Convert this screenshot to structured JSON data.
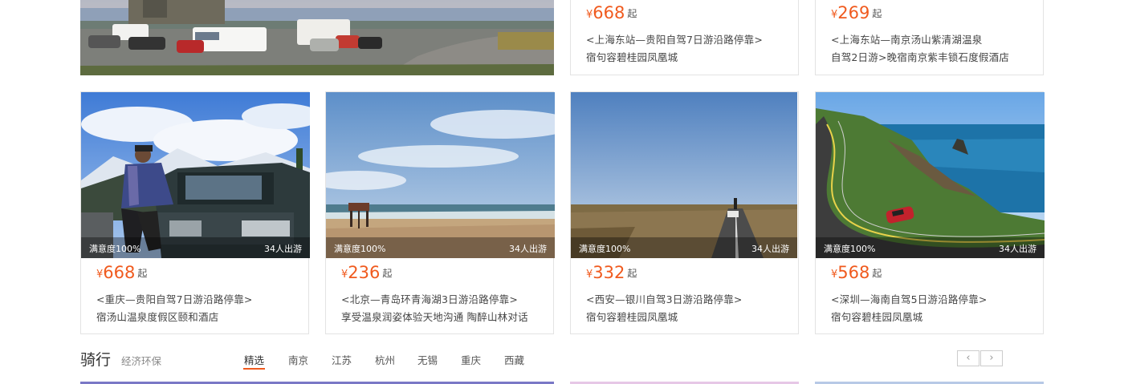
{
  "top_row": [
    {
      "price_symbol": "¥",
      "price": "668",
      "price_suffix": "起",
      "line1": "<上海东站—贵阳自驾7日游沿路停靠>",
      "line2": "宿句容碧桂园凤凰城"
    },
    {
      "price_symbol": "¥",
      "price": "269",
      "price_suffix": "起",
      "line1": "<上海东站—南京汤山紫清湖温泉",
      "line2": "自驾2日游>晚宿南京紫丰锁石度假酒店"
    }
  ],
  "cards": [
    {
      "satisfaction": "满意度100%",
      "travelers": "34人出游",
      "price_symbol": "¥",
      "price": "668",
      "price_suffix": "起",
      "line1": "<重庆—贵阳自驾7日游沿路停靠>",
      "line2": "宿汤山温泉度假区颐和酒店"
    },
    {
      "satisfaction": "满意度100%",
      "travelers": "34人出游",
      "price_symbol": "¥",
      "price": "236",
      "price_suffix": "起",
      "line1": "<北京—青岛环青海湖3日游沿路停靠>",
      "line2": "享受温泉润姿体验天地沟通  陶醉山林对话"
    },
    {
      "satisfaction": "满意度100%",
      "travelers": "34人出游",
      "price_symbol": "¥",
      "price": "332",
      "price_suffix": "起",
      "line1": "<西安—银川自驾3日游沿路停靠>",
      "line2": "宿句容碧桂园凤凰城"
    },
    {
      "satisfaction": "满意度100%",
      "travelers": "34人出游",
      "price_symbol": "¥",
      "price": "568",
      "price_suffix": "起",
      "line1": "<深圳—海南自驾5日游沿路停靠>",
      "line2": "宿句容碧桂园凤凰城"
    }
  ],
  "section": {
    "title": "骑行",
    "subtitle": "经济环保",
    "tabs": [
      "精选",
      "南京",
      "江苏",
      "杭州",
      "无锡",
      "重庆",
      "西藏"
    ],
    "prev_icon": "‹",
    "next_icon": "›"
  },
  "colors": {
    "accent": "#f05a1e",
    "border": "#e3e3e3"
  },
  "icons": {
    "prev": "chevron-left-icon",
    "next": "chevron-right-icon"
  }
}
